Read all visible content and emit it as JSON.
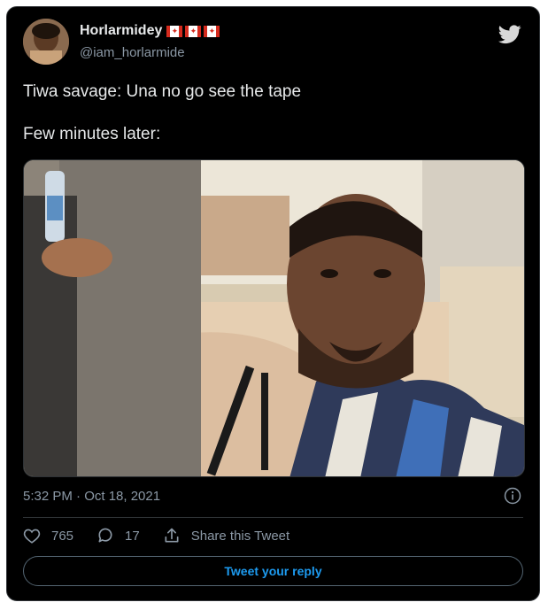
{
  "author": {
    "display_name": "Horlarmidey",
    "handle": "@iam_horlarmide",
    "flags": [
      "canada-flag",
      "canada-flag",
      "canada-flag"
    ]
  },
  "tweet": {
    "text": "Tiwa savage: Una no go see the tape\n\nFew minutes later:",
    "media": "photo: man in striped sweater looking at camera in ornate room",
    "timestamp": "5:32 PM · Oct 18, 2021"
  },
  "actions": {
    "likes": "765",
    "replies": "17",
    "share_label": "Share this Tweet"
  },
  "reply_button": "Tweet your reply",
  "colors": {
    "background": "#000000",
    "text": "#e7e9ea",
    "secondary": "#8b98a5",
    "accent": "#1d9bf0",
    "border": "#2f3336"
  },
  "icons": [
    "twitter-bird-icon",
    "info-icon",
    "heart-icon",
    "reply-icon",
    "share-icon"
  ]
}
